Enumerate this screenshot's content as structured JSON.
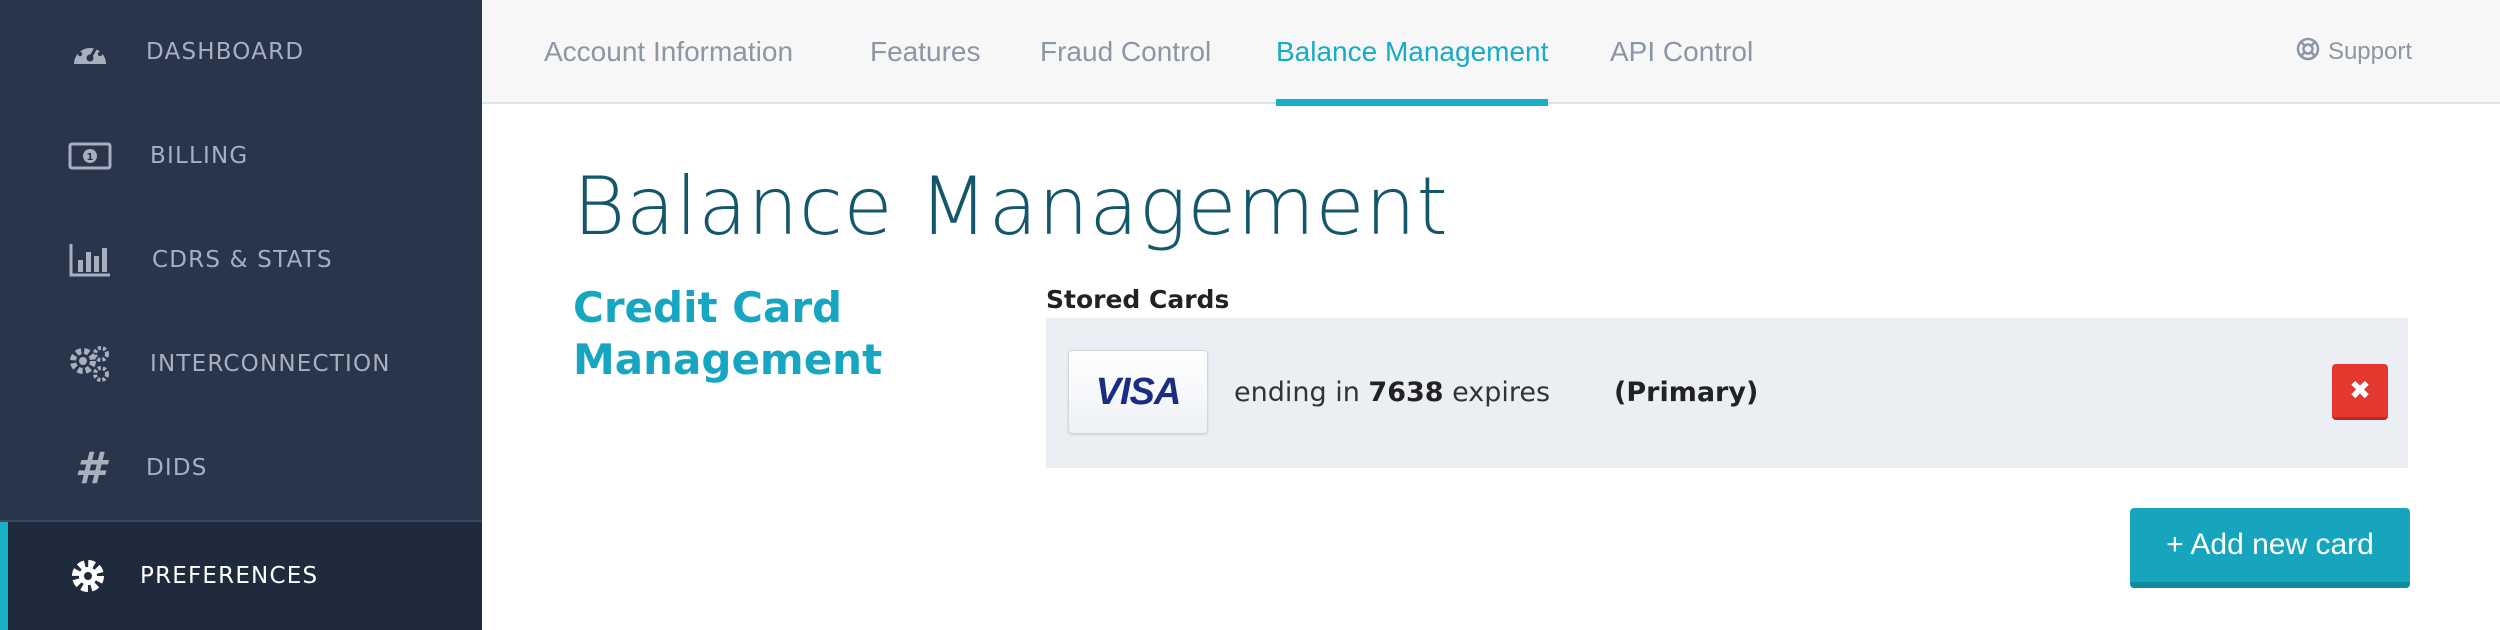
{
  "sidebar": {
    "items": [
      {
        "label": "DASHBOARD",
        "icon": "dashboard-gauge-icon"
      },
      {
        "label": "BILLING",
        "icon": "money-bill-icon"
      },
      {
        "label": "CDRS & STATS",
        "icon": "bar-chart-icon"
      },
      {
        "label": "INTERCONNECTION",
        "icon": "gears-icon"
      },
      {
        "label": "DIDS",
        "icon": "hashtag-icon"
      },
      {
        "label": "PREFERENCES",
        "icon": "gear-icon",
        "active": true
      }
    ]
  },
  "topnav": {
    "tabs": [
      {
        "label": "Account Information"
      },
      {
        "label": "Features"
      },
      {
        "label": "Fraud Control"
      },
      {
        "label": "Balance Management",
        "active": true
      },
      {
        "label": "API Control"
      }
    ],
    "support_label": "Support"
  },
  "main": {
    "title": "Balance Management",
    "section_title": "Credit Card Management",
    "stored_cards_label": "Stored Cards",
    "cards": [
      {
        "brand": "VISA",
        "ending_prefix": "ending in",
        "last4": "7638",
        "expires_label": "expires",
        "primary_label": "(Primary)",
        "delete_label": "✖"
      }
    ],
    "add_card_label": "+ Add new card"
  },
  "colors": {
    "accent": "#17b0c7",
    "sidebar_bg": "#28354a",
    "title": "#14576b",
    "danger": "#e3372f"
  }
}
